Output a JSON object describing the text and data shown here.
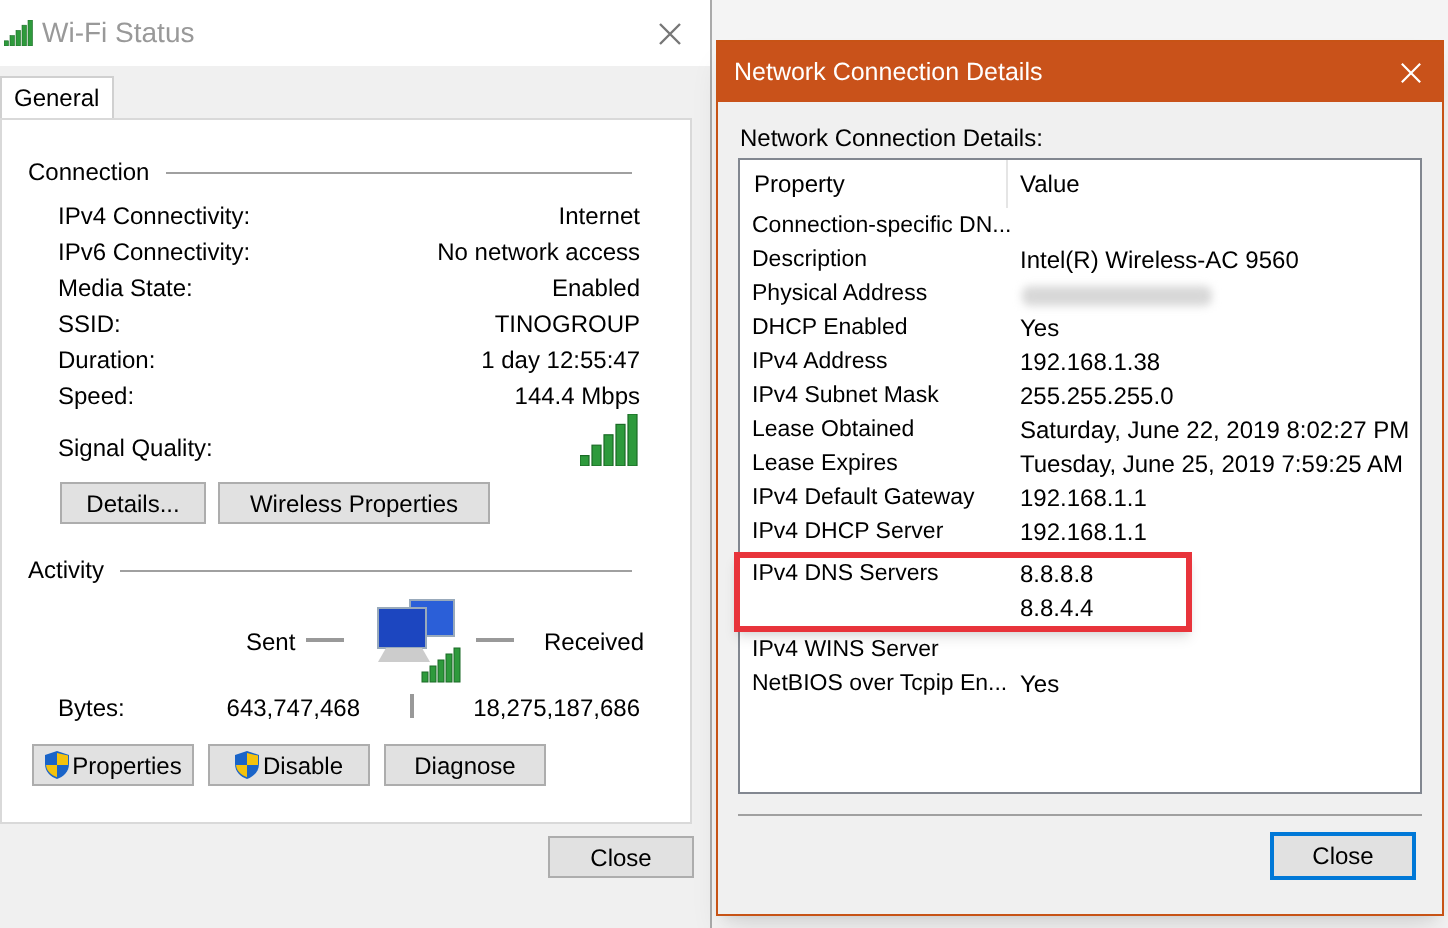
{
  "status_window": {
    "title": "Wi-Fi Status",
    "tabs": [
      {
        "label": "General",
        "selected": true
      }
    ],
    "connection": {
      "title": "Connection",
      "rows": [
        {
          "label": "IPv4 Connectivity:",
          "value": "Internet"
        },
        {
          "label": "IPv6 Connectivity:",
          "value": "No network access"
        },
        {
          "label": "Media State:",
          "value": "Enabled"
        },
        {
          "label": "SSID:",
          "value": "TINOGROUP"
        },
        {
          "label": "Duration:",
          "value": "1 day 12:55:47"
        },
        {
          "label": "Speed:",
          "value": "144.4 Mbps"
        }
      ],
      "signal_label": "Signal Quality:",
      "buttons": [
        "Details...",
        "Wireless Properties"
      ]
    },
    "activity": {
      "title": "Activity",
      "sent_label": "Sent",
      "received_label": "Received",
      "bytes_label": "Bytes:",
      "sent_bytes": "643,747,468",
      "received_bytes": "18,275,187,686",
      "buttons": [
        {
          "label": "Properties",
          "kind": "shield"
        },
        {
          "label": "Disable",
          "kind": "shield"
        },
        {
          "label": "Diagnose",
          "kind": "plain"
        }
      ]
    },
    "close_button": {
      "label": "Close",
      "focused": false
    }
  },
  "details_window": {
    "title": "Network Connection Details",
    "heading": "Network Connection Details:",
    "columns": [
      "Property",
      "Value"
    ],
    "rows": [
      {
        "property": "Connection-specific DN...",
        "kind": "text"
      },
      {
        "property": "Description",
        "value": "Intel(R) Wireless-AC 9560",
        "kind": "text"
      },
      {
        "property": "Physical Address",
        "kind": "blurred"
      },
      {
        "property": "DHCP Enabled",
        "value": "Yes",
        "kind": "text"
      },
      {
        "property": "IPv4 Address",
        "value": "192.168.1.38",
        "kind": "text"
      },
      {
        "property": "IPv4 Subnet Mask",
        "value": "255.255.255.0",
        "kind": "text"
      },
      {
        "property": "Lease Obtained",
        "value": "Saturday, June 22, 2019 8:02:27 PM",
        "kind": "text"
      },
      {
        "property": "Lease Expires",
        "value": "Tuesday, June 25, 2019 7:59:25 AM",
        "kind": "text"
      },
      {
        "property": "IPv4 Default Gateway",
        "value": "192.168.1.1",
        "kind": "text"
      },
      {
        "property": "IPv4 DHCP Server",
        "value": "192.168.1.1",
        "kind": "text"
      },
      {
        "property": "IPv4 DNS Servers",
        "values": [
          "8.8.8.8",
          "8.8.4.4"
        ],
        "kind": "multi",
        "highlighted": true
      },
      {
        "property": "IPv4 WINS Server",
        "kind": "text"
      },
      {
        "property": "NetBIOS over Tcpip En...",
        "value": "Yes",
        "kind": "text"
      }
    ],
    "close_button": {
      "label": "Close",
      "focused": true
    }
  }
}
